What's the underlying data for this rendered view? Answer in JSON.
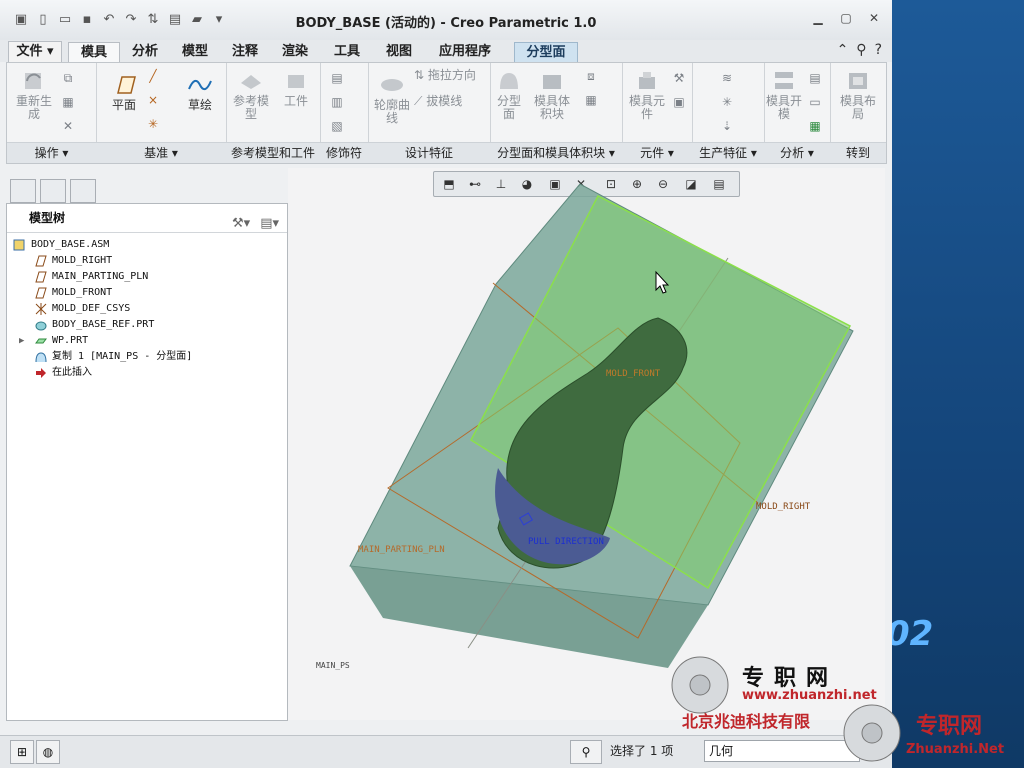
{
  "window": {
    "title": "BODY_BASE (活动的) - Creo Parametric 1.0"
  },
  "tabs": [
    "文件",
    "模具",
    "分析",
    "模型",
    "注释",
    "渲染",
    "工具",
    "视图",
    "应用程序",
    "分型面"
  ],
  "ribbon": {
    "groups": [
      {
        "label": "操作",
        "buttons": [
          "重新生成"
        ]
      },
      {
        "label": "基准",
        "buttons": [
          "平面",
          "草绘"
        ]
      },
      {
        "label": "参考模型和工件",
        "buttons": [
          "参考模型",
          "工件"
        ]
      },
      {
        "label": "修饰符",
        "buttons": []
      },
      {
        "label": "设计特征",
        "buttons": [
          "轮廓曲线",
          "拖拉方向",
          "拔模线"
        ]
      },
      {
        "label": "分型面和模具体积块",
        "buttons": [
          "分型面",
          "模具体积块"
        ]
      },
      {
        "label": "元件",
        "buttons": [
          "模具元件"
        ]
      },
      {
        "label": "生产特征",
        "buttons": []
      },
      {
        "label": "分析",
        "buttons": [
          "模具开模"
        ]
      },
      {
        "label": "转到",
        "buttons": [
          "模具布局"
        ]
      }
    ]
  },
  "model_tree": {
    "title": "模型树",
    "items": [
      {
        "label": "BODY_BASE.ASM",
        "icon": "assembly-icon"
      },
      {
        "label": "MOLD_RIGHT",
        "icon": "datum-plane-icon"
      },
      {
        "label": "MAIN_PARTING_PLN",
        "icon": "datum-plane-icon"
      },
      {
        "label": "MOLD_FRONT",
        "icon": "datum-plane-icon"
      },
      {
        "label": "MOLD_DEF_CSYS",
        "icon": "csys-icon"
      },
      {
        "label": "BODY_BASE_REF.PRT",
        "icon": "part-icon"
      },
      {
        "label": "WP.PRT",
        "icon": "workpiece-icon"
      },
      {
        "label": "复制 1 [MAIN_PS - 分型面]",
        "icon": "surface-icon"
      },
      {
        "label": "在此插入",
        "icon": "insert-arrow-icon"
      }
    ]
  },
  "viewport": {
    "labels": {
      "mold_front": "MOLD_FRONT",
      "mold_right": "MOLD_RIGHT",
      "main_parting_pln": "MAIN_PARTING_PLN",
      "pull_direction": "PULL DIRECTION",
      "main_ps": "MAIN_PS"
    },
    "colors": {
      "workpiece": "#7aa79a",
      "surface": "#7fcf6a",
      "part": "#3f6b3f",
      "datum": "#b56a2a"
    }
  },
  "status": {
    "selection": "选择了 1 项",
    "filter": "几何"
  },
  "watermark": {
    "site_cn": "专职网",
    "url": "www.zhuanzhi.net",
    "company": "北京兆迪科技有限",
    "site_cn2": "专职网",
    "url2": "Zhuanzhi.Net"
  },
  "desktop_number": "02"
}
